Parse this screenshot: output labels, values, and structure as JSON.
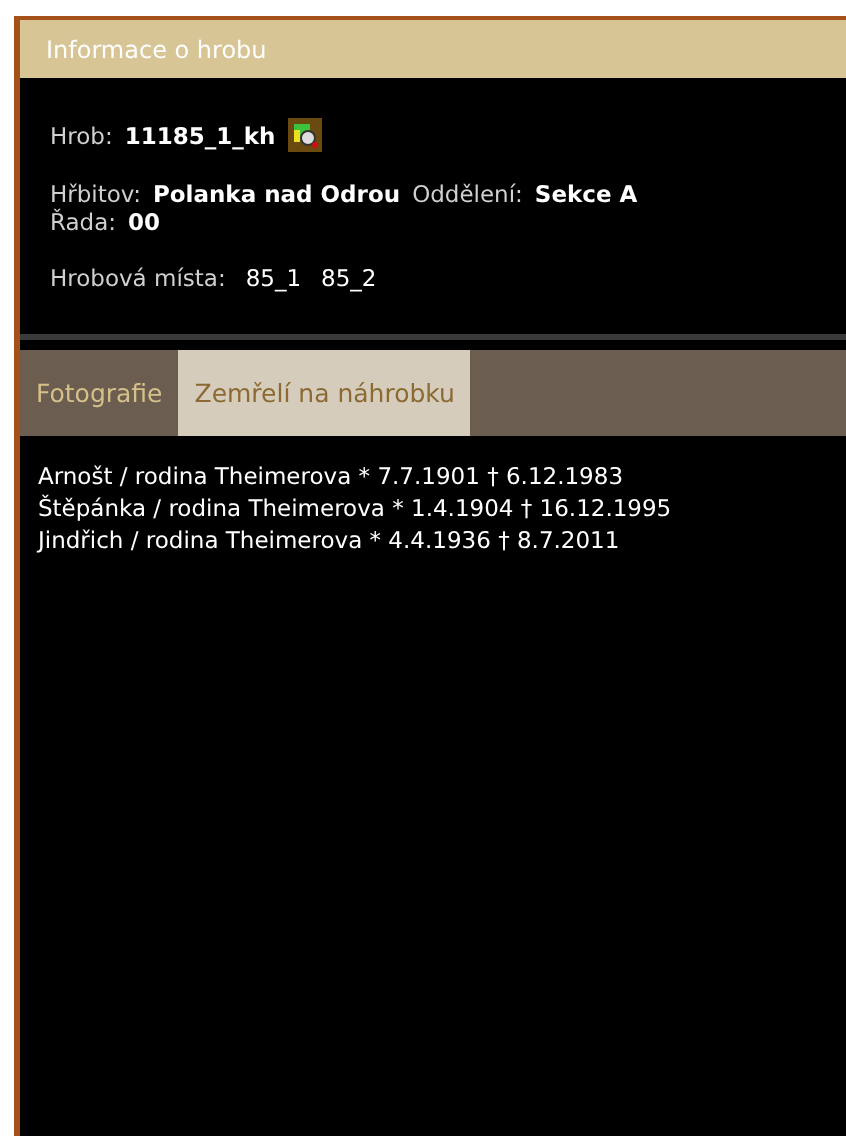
{
  "window": {
    "title": "Informace o hrobu"
  },
  "grave": {
    "label": "Hrob:",
    "value": "11185_1_kh"
  },
  "cemetery": {
    "label": "Hřbitov:",
    "value": "Polanka nad Odrou"
  },
  "section": {
    "label": "Oddělení:",
    "value": "Sekce A"
  },
  "row": {
    "label": "Řada:",
    "value": "00"
  },
  "places": {
    "label": "Hrobová místa:",
    "values": [
      "85_1",
      "85_2"
    ]
  },
  "tabs": [
    {
      "label": "Fotografie",
      "selected": false
    },
    {
      "label": "Zemřelí na náhrobku",
      "selected": true
    }
  ],
  "deceased": [
    {
      "name": "Arnošt / rodina Theimerova",
      "born": "* 7.7.1901",
      "died": "† 6.12.1983"
    },
    {
      "name": "Štěpánka / rodina Theimerova",
      "born": "* 1.4.1904",
      "died": "† 16.12.1995"
    },
    {
      "name": "Jindřich / rodina Theimerova",
      "born": "* 4.4.1936",
      "died": "† 8.7.2011"
    }
  ]
}
